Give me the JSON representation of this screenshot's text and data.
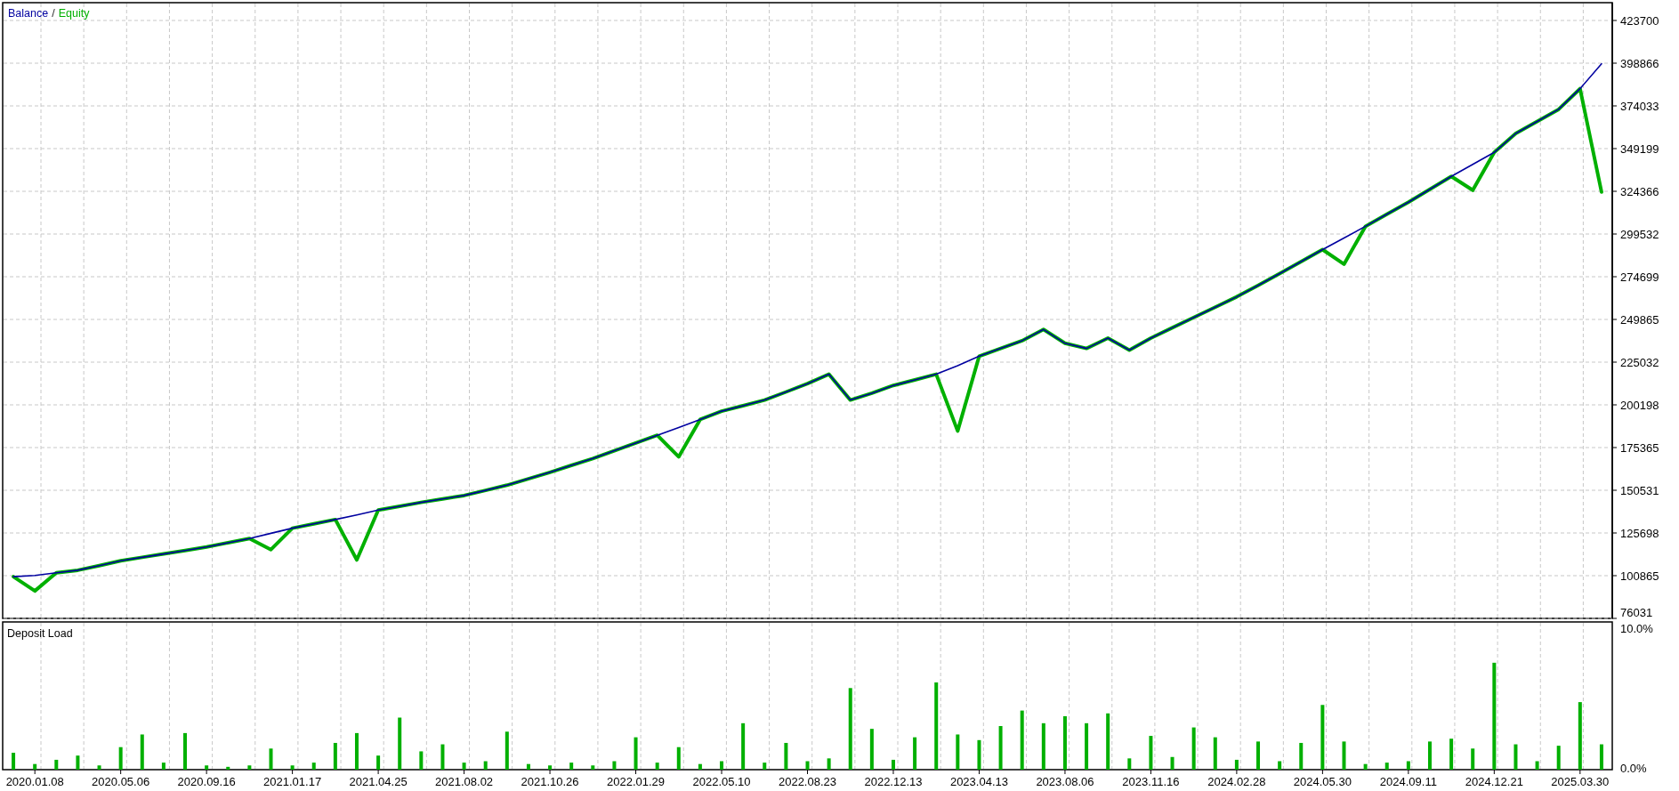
{
  "balance_chart": {
    "legend_separator": "/",
    "chart_data": {
      "type": "line",
      "grid": true,
      "ylim": [
        76031,
        423700
      ],
      "yticks": [
        76031,
        100865,
        125698,
        150531,
        175365,
        200198,
        225032,
        249865,
        274699,
        299532,
        324366,
        349199,
        374033,
        398866,
        423700
      ],
      "series": [
        {
          "name": "Balance",
          "color": "#0000a0",
          "values": [
            100300,
            101000,
            102500,
            104000,
            106700,
            109500,
            111500,
            113500,
            115500,
            117500,
            120000,
            122500,
            125500,
            128500,
            131000,
            133500,
            136200,
            139000,
            141200,
            143500,
            145500,
            147500,
            150500,
            153500,
            157200,
            161000,
            165000,
            169000,
            173500,
            178000,
            182500,
            187000,
            191700,
            196500,
            199700,
            203000,
            207700,
            212500,
            218000,
            203000,
            207000,
            211500,
            214700,
            218000,
            223000,
            228500,
            233000,
            237500,
            244000,
            236000,
            233000,
            239000,
            232000,
            239000,
            245000,
            251000,
            257000,
            263000,
            269700,
            276500,
            283500,
            290500,
            297200,
            304000,
            311000,
            318000,
            325500,
            333000,
            340000,
            347000,
            358000,
            365000,
            372000,
            384000,
            398500
          ]
        },
        {
          "name": "Equity",
          "color": "#00b000",
          "values": [
            100300,
            92000,
            102500,
            104000,
            106700,
            109500,
            111500,
            113500,
            115500,
            117500,
            120000,
            122500,
            116000,
            128500,
            131000,
            133500,
            110000,
            139000,
            141200,
            143500,
            145500,
            147500,
            150500,
            153500,
            157200,
            161000,
            165000,
            169000,
            173500,
            178000,
            182500,
            170000,
            191700,
            196500,
            199700,
            203000,
            207700,
            212500,
            218000,
            203000,
            207000,
            211500,
            214700,
            218000,
            185000,
            228500,
            233000,
            237500,
            244000,
            236000,
            233000,
            239000,
            232000,
            239000,
            245000,
            251000,
            257000,
            263000,
            269700,
            276500,
            283500,
            290500,
            282000,
            304000,
            311000,
            318000,
            325500,
            333000,
            325000,
            347000,
            358000,
            365000,
            372000,
            384000,
            324000
          ]
        }
      ]
    }
  },
  "deposit_load_chart": {
    "chart_data": {
      "type": "bar",
      "title": "Deposit Load",
      "grid": true,
      "ylim": [
        0,
        10.5
      ],
      "yticks": [
        {
          "value": 0,
          "label": "0.0%"
        },
        {
          "value": 10,
          "label": "10.0%"
        }
      ],
      "categories": [
        null,
        "2020.01.08",
        null,
        null,
        null,
        "2020.05.06",
        null,
        null,
        null,
        "2020.09.16",
        null,
        null,
        null,
        "2021.01.17",
        null,
        null,
        null,
        "2021.04.25",
        null,
        null,
        null,
        "2021.08.02",
        null,
        null,
        null,
        "2021.10.26",
        null,
        null,
        null,
        "2022.01.29",
        null,
        null,
        null,
        "2022.05.10",
        null,
        null,
        null,
        "2022.08.23",
        null,
        null,
        null,
        "2022.12.13",
        null,
        null,
        null,
        "2023.04.13",
        null,
        null,
        null,
        "2023.08.06",
        null,
        null,
        null,
        "2023.11.16",
        null,
        null,
        null,
        "2024.02.28",
        null,
        null,
        null,
        "2024.05.30",
        null,
        null,
        null,
        "2024.09.11",
        null,
        null,
        null,
        "2024.12.21",
        null,
        null,
        null,
        "2025.03.30",
        null
      ],
      "values": [
        1.2,
        0.4,
        0.7,
        1.0,
        0.3,
        1.6,
        2.5,
        0.5,
        2.6,
        0.3,
        0.2,
        0.3,
        1.5,
        0.3,
        0.5,
        1.9,
        2.6,
        1.0,
        3.7,
        1.3,
        1.8,
        0.5,
        0.6,
        2.7,
        0.4,
        0.3,
        0.5,
        0.3,
        0.6,
        2.3,
        0.5,
        1.6,
        0.4,
        0.6,
        3.3,
        0.5,
        1.9,
        0.6,
        0.8,
        5.8,
        2.9,
        0.7,
        2.3,
        6.2,
        2.5,
        2.1,
        3.1,
        4.2,
        3.3,
        3.8,
        3.3,
        4.0,
        0.8,
        2.4,
        0.9,
        3.0,
        2.3,
        0.7,
        2.0,
        0.6,
        1.9,
        4.6,
        2.0,
        0.4,
        0.5,
        0.6,
        2.0,
        2.2,
        1.5,
        7.6,
        1.8,
        0.6,
        1.7,
        4.8,
        1.8
      ]
    }
  }
}
